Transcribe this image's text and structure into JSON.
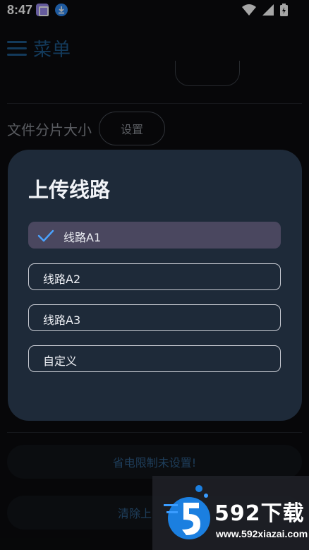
{
  "status_bar": {
    "time": "8:47",
    "icons": [
      "app-hexagon-icon",
      "download-icon",
      "wifi-icon",
      "cellular-icon",
      "battery-charging-icon"
    ]
  },
  "header": {
    "title": "菜单",
    "menu_icon": "hamburger-menu-icon",
    "accent_color": "#1e5a8c"
  },
  "background_page": {
    "file_chunk_label": "文件分片大小",
    "file_chunk_button": "设置",
    "power_limit_button": "省电限制未设置!",
    "clear_button_partial": "清除上"
  },
  "dialog": {
    "title": "上传线路",
    "options": [
      {
        "label": "线路A1",
        "selected": true
      },
      {
        "label": "线路A2",
        "selected": false
      },
      {
        "label": "线路A3",
        "selected": false
      },
      {
        "label": "自定义",
        "selected": false
      }
    ],
    "selected_color": "#4a475f",
    "check_color": "#4aa3ff"
  },
  "watermark": {
    "brand": "592下载",
    "url": "www.592xiazai.com"
  }
}
